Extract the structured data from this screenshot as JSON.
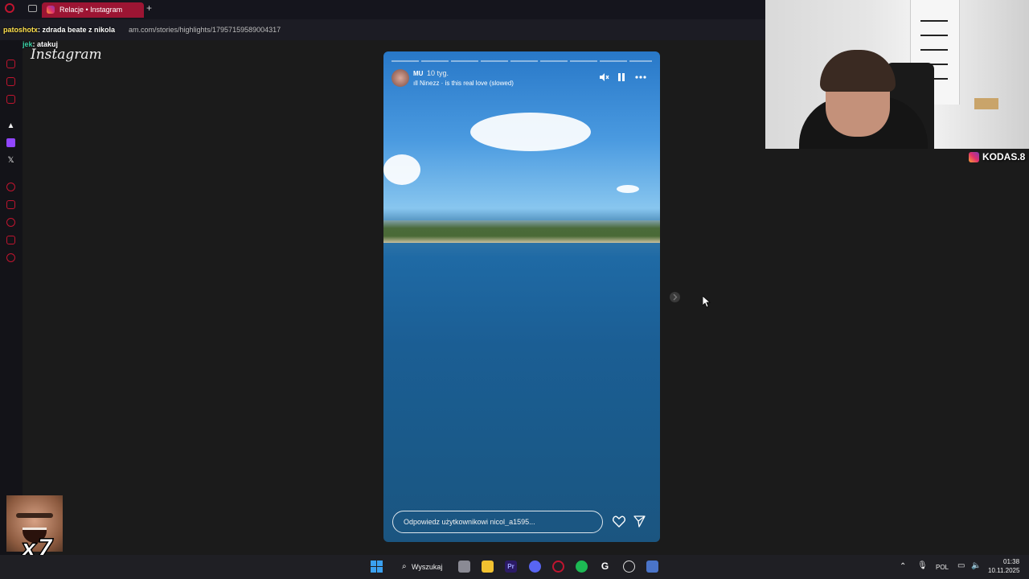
{
  "browser": {
    "tab_title": "Relacje • Instagram",
    "new_tab_symbol": "+",
    "url_visible": "am.com/stories/highlights/17957159589004317"
  },
  "chat": {
    "lines": [
      {
        "user": "patoshotx",
        "message": ": zdrada beate z nikola"
      },
      {
        "user": "Kk_kijek",
        "message": ": atakuj"
      }
    ]
  },
  "sidebar": {
    "icons": [
      "opera-icon",
      "messenger-icon",
      "instagram-sidebar-icon",
      "aria-icon",
      "twitch-icon",
      "x-icon",
      "history-icon",
      "bookmark-icon",
      "clock-icon",
      "extensions-icon",
      "settings-icon"
    ]
  },
  "instagram": {
    "logo": "Instagram"
  },
  "story": {
    "username": "MU",
    "time_ago": "10 tyg.",
    "music": "Ninezz · is this real love (slowed)",
    "reply_placeholder": "Odpowiedz użytkownikowi nicol_a1595...",
    "segments_total": 9
  },
  "stream_overlay": {
    "instagram_handle": "KODAS.8",
    "emote_text": "x7"
  },
  "taskbar": {
    "search_label": "Wyszukaj",
    "language": "POL",
    "time": "01:38",
    "date": "10.11.2025",
    "apps": [
      "file-explorer-icon",
      "premiere-icon",
      "discord-icon",
      "opera-icon",
      "spotify-icon",
      "app-g-icon",
      "chatgpt-icon",
      "calculator-icon"
    ]
  },
  "colors": {
    "accent": "#9c1533",
    "opera_red": "#c0152f",
    "background": "#1b1b1b"
  }
}
